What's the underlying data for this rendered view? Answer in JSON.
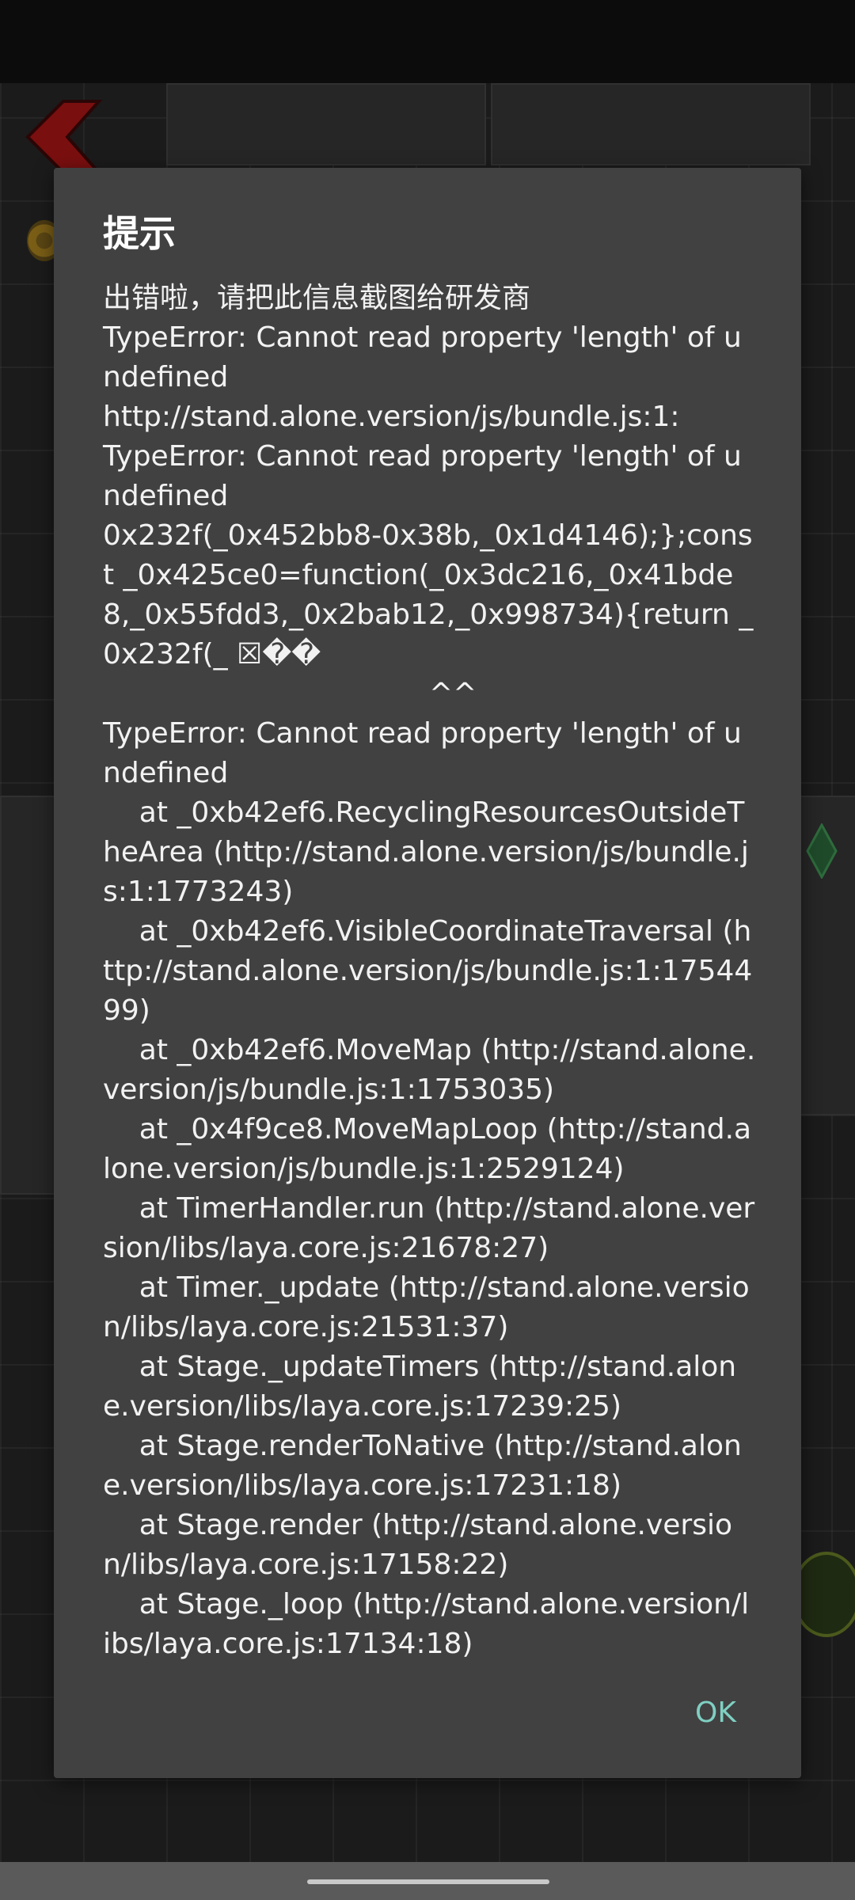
{
  "dialog": {
    "title": "提示",
    "message": [
      "出错啦，请把此信息截图给研发商",
      "TypeError: Cannot read property 'length' of undefined",
      "http://stand.alone.version/js/bundle.js:1:",
      "TypeError: Cannot read property 'length' of undefined",
      "0x232f(_0x452bb8-0x38b,_0x1d4146);};const _0x425ce0=function(_0x3dc216,_0x41bde8,_0x55fdd3,_0x2bab12,_0x998734){return _0x232f(_ ☒��",
      "                                    ^^",
      "TypeError: Cannot read property 'length' of undefined",
      "    at _0xb42ef6.RecyclingResourcesOutsideTheArea (http://stand.alone.version/js/bundle.js:1:1773243)",
      "    at _0xb42ef6.VisibleCoordinateTraversal (http://stand.alone.version/js/bundle.js:1:1754499)",
      "    at _0xb42ef6.MoveMap (http://stand.alone.version/js/bundle.js:1:1753035)",
      "    at _0x4f9ce8.MoveMapLoop (http://stand.alone.version/js/bundle.js:1:2529124)",
      "    at TimerHandler.run (http://stand.alone.version/libs/laya.core.js:21678:27)",
      "    at Timer._update (http://stand.alone.version/libs/laya.core.js:21531:37)",
      "    at Stage._updateTimers (http://stand.alone.version/libs/laya.core.js:17239:25)",
      "    at Stage.renderToNative (http://stand.alone.version/libs/laya.core.js:17231:18)",
      "    at Stage.render (http://stand.alone.version/libs/laya.core.js:17158:22)",
      "    at Stage._loop (http://stand.alone.version/libs/laya.core.js:17134:18)"
    ],
    "ok_label": "OK"
  },
  "background": {
    "icons": [
      "back-arrow-icon",
      "gold-coin-icon",
      "gem-icon"
    ],
    "accent_colors": {
      "back_arrow": "#7a0f0f",
      "ok_text": "#7fcfc2",
      "dialog_bg": "#414141"
    }
  }
}
